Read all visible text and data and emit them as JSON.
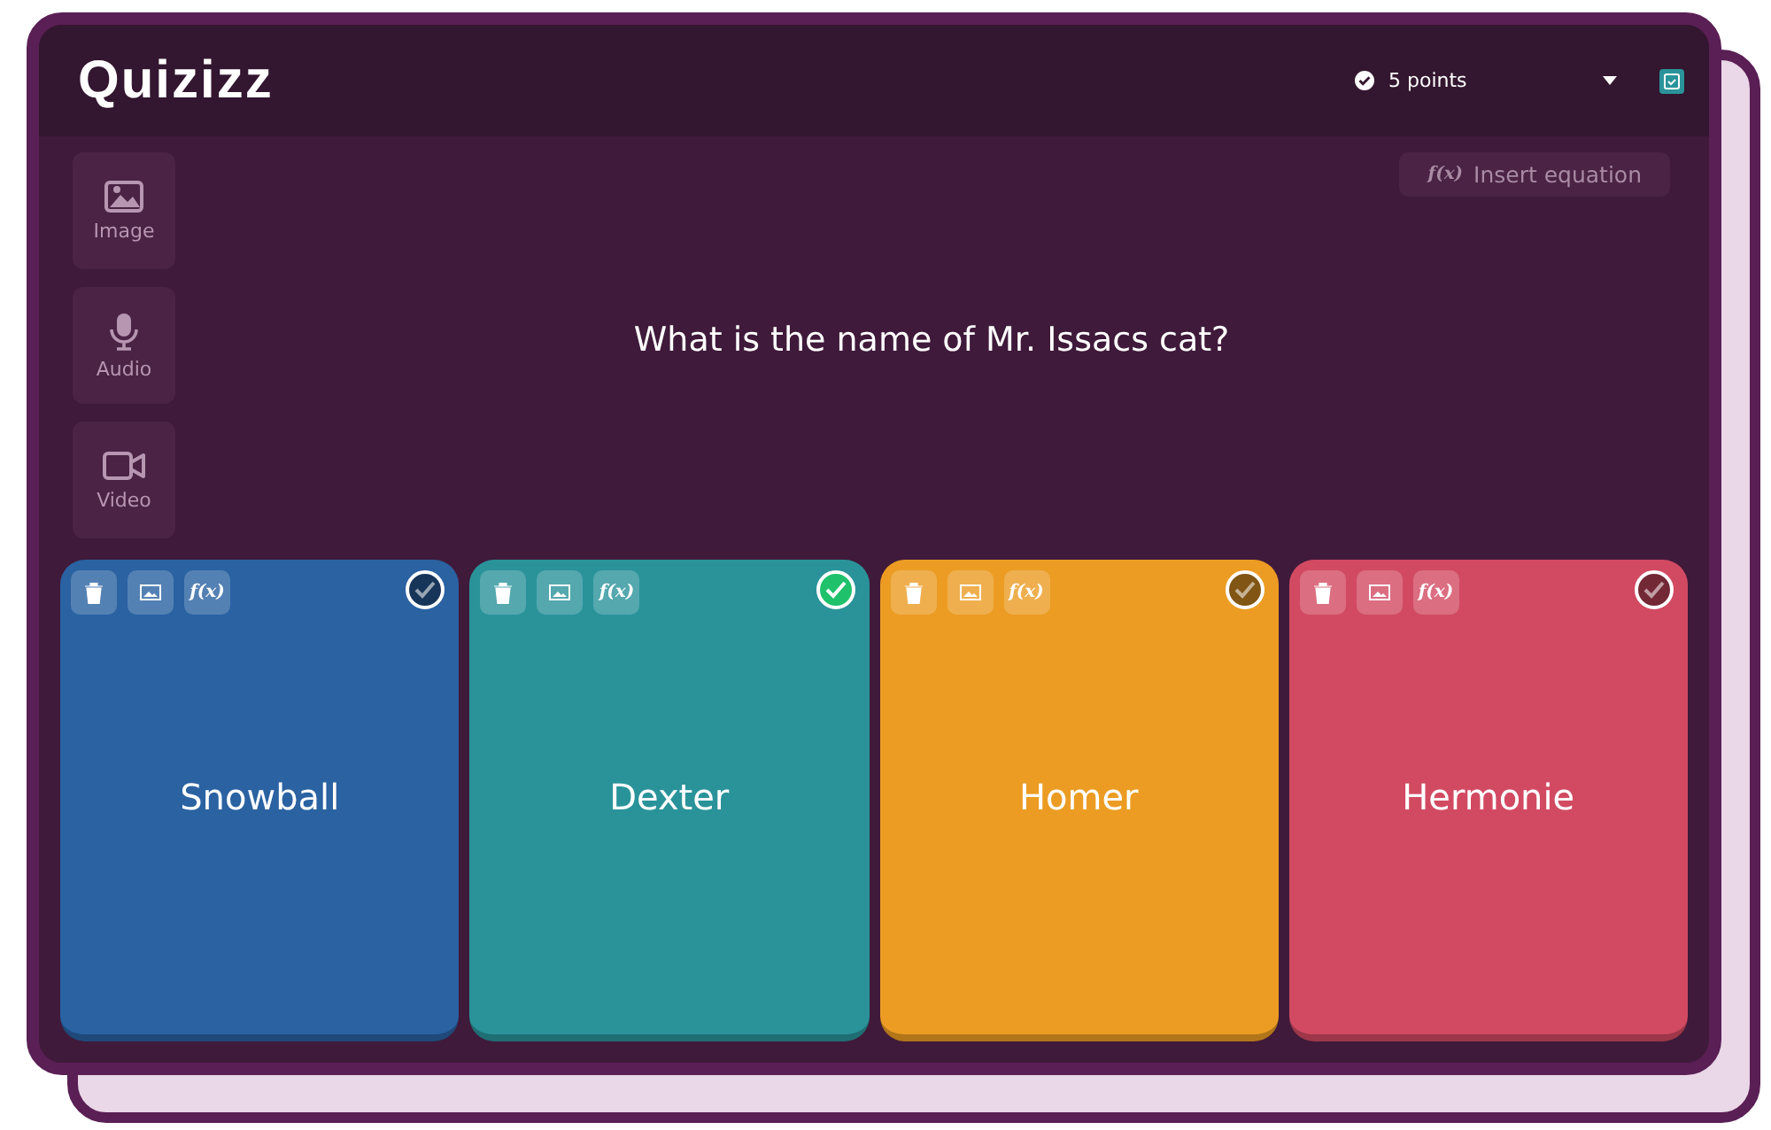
{
  "logo": "Quizizz",
  "header": {
    "points": "5 points"
  },
  "media_buttons": [
    {
      "kind": "image",
      "label": "Image"
    },
    {
      "kind": "audio",
      "label": "Audio"
    },
    {
      "kind": "video",
      "label": "Video"
    }
  ],
  "insert_equation": {
    "icon": "f(x)",
    "label": "Insert equation"
  },
  "question": "What is the name of Mr. Issacs cat?",
  "answers": [
    {
      "text": "Snowball",
      "color": "#2a62a2",
      "correct": false,
      "formula_icon": "f(x)"
    },
    {
      "text": "Dexter",
      "color": "#2a939a",
      "correct": true,
      "formula_icon": "f(x)"
    },
    {
      "text": "Homer",
      "color": "#ec9c23",
      "correct": false,
      "formula_icon": "f(x)"
    },
    {
      "text": "Hermonie",
      "color": "#d24a62",
      "correct": false,
      "formula_icon": "f(x)"
    }
  ]
}
